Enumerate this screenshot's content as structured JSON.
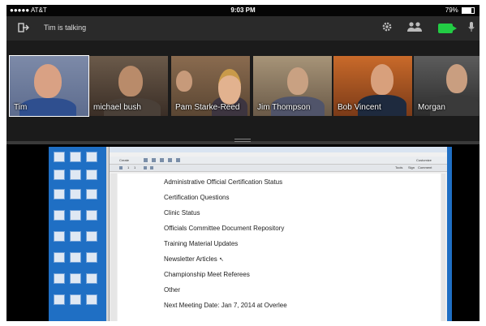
{
  "status_bar": {
    "carrier": "●●●●● AT&T",
    "time": "9:03 PM",
    "battery": "79%",
    "battery_level": 0.79
  },
  "toolbar": {
    "exit_icon": "exit-door-icon",
    "talking_label": "Tim is talking",
    "settings_icon": "gear-icon",
    "people_icon": "people-icon",
    "camera_icon": "video-camera-icon",
    "camera_color": "#22cc44",
    "mic_icon": "microphone-icon"
  },
  "participants": [
    {
      "name": "Tim",
      "active": true
    },
    {
      "name": "michael bush",
      "active": false
    },
    {
      "name": "Pam Starke-Reed",
      "active": false
    },
    {
      "name": "Jim Thompson",
      "active": false
    },
    {
      "name": "Bob Vincent",
      "active": false
    },
    {
      "name": "Morgan",
      "active": false
    }
  ],
  "shared_screen": {
    "app_buttons": {
      "create": "Create",
      "customize": "Customize",
      "tools": "Tools",
      "sign": "Sign",
      "comment": "Comment",
      "page_number": "1",
      "page_total": "1"
    },
    "agenda_items": [
      "Administrative Official Certification Status",
      "Certification Questions",
      "Clinic Status",
      "Officials Committee Document Repository",
      "Training Material Updates",
      "Newsletter Articles",
      "Championship Meet Referees",
      "Other",
      "Next Meeting Date: Jan 7, 2014 at Overlee"
    ]
  }
}
